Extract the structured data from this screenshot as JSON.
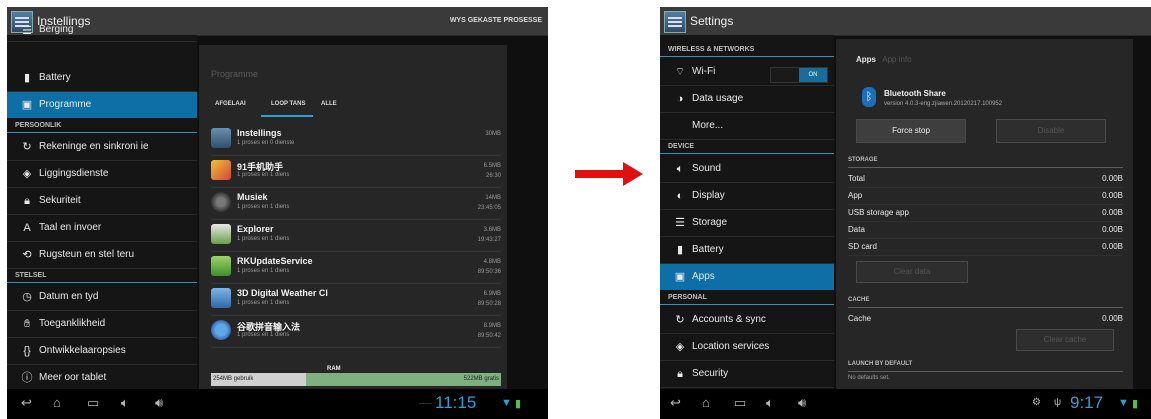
{
  "left": {
    "title": "Instellings",
    "header_right": "WYS GEKASTE PROSESSE",
    "sidebar": {
      "top_partial": "Berging",
      "battery": "Battery",
      "apps": "Programme",
      "personal_header": "PERSOONLIK",
      "accounts": "Rekeninge en sinkroni ie",
      "location": "Liggingsdienste",
      "security": "Sekuriteit",
      "language": "Taal en invoer",
      "backup": "Rugsteun en stel teru",
      "system_header": "STELSEL",
      "datetime": "Datum en tyd",
      "accessibility": "Toeganklikheid",
      "developer": "Ontwikkelaaropsies",
      "about": "Meer oor tablet"
    },
    "panel_title": "Programme",
    "tabs": [
      "AFGELAAI",
      "LOOP TANS",
      "ALLE"
    ],
    "processes": [
      {
        "name": "Instellings",
        "desc": "1 proses en 0 dienste",
        "size": "30MB",
        "time": ""
      },
      {
        "name": "91手机助手",
        "desc": "1 proses en 1 diens",
        "size": "6.5MB",
        "time": "26:30"
      },
      {
        "name": "Musiek",
        "desc": "1 proses en 1 diens",
        "size": "14MB",
        "time": "23:45:05"
      },
      {
        "name": "Explorer",
        "desc": "1 proses en 1 diens",
        "size": "3.6MB",
        "time": "19:43:27"
      },
      {
        "name": "RKUpdateService",
        "desc": "1 proses en 1 diens",
        "size": "4.8MB",
        "time": "89:50:36"
      },
      {
        "name": "3D Digital Weather Cl",
        "desc": "1 proses en 1 diens",
        "size": "6.9MB",
        "time": "89:50:28"
      },
      {
        "name": "谷歌拼音输入法",
        "desc": "1 proses en 1 diens",
        "size": "8.9MB",
        "time": "89:50:42"
      }
    ],
    "ram": {
      "label": "RAM",
      "used": "254MB gebruik",
      "free": "522MB gratis"
    },
    "clock": "11:15"
  },
  "right": {
    "title": "Settings",
    "sidebar": {
      "wireless_header": "WIRELESS & NETWORKS",
      "wifi": "Wi-Fi",
      "wifi_toggle": "ON",
      "data_usage": "Data usage",
      "more": "More...",
      "device_header": "DEVICE",
      "sound": "Sound",
      "display": "Display",
      "storage": "Storage",
      "battery": "Battery",
      "apps": "Apps",
      "personal_header": "PERSONAL",
      "accounts": "Accounts & sync",
      "location": "Location services",
      "security": "Security"
    },
    "breadcrumb": {
      "apps": "Apps",
      "app_info": "App info"
    },
    "app": {
      "name": "Bluetooth Share",
      "version": "version 4.0.3-eng.zjiawen.20120217.100952"
    },
    "buttons": {
      "force_stop": "Force stop",
      "disable": "Disable",
      "clear_data": "Clear data",
      "clear_cache": "Clear cache"
    },
    "storage_header": "STORAGE",
    "storage": [
      {
        "label": "Total",
        "value": "0.00B"
      },
      {
        "label": "App",
        "value": "0.00B"
      },
      {
        "label": "USB storage app",
        "value": "0.00B"
      },
      {
        "label": "Data",
        "value": "0.00B"
      },
      {
        "label": "SD card",
        "value": "0.00B"
      }
    ],
    "cache_header": "CACHE",
    "cache": {
      "label": "Cache",
      "value": "0.00B"
    },
    "launch_header": "LAUNCH BY DEFAULT",
    "launch_text": "No defaults set.",
    "clock": "9:17"
  },
  "colors": {
    "accent": "#0e6fa6",
    "arrow": "#e01010",
    "ram_free": "#7fb07f"
  }
}
